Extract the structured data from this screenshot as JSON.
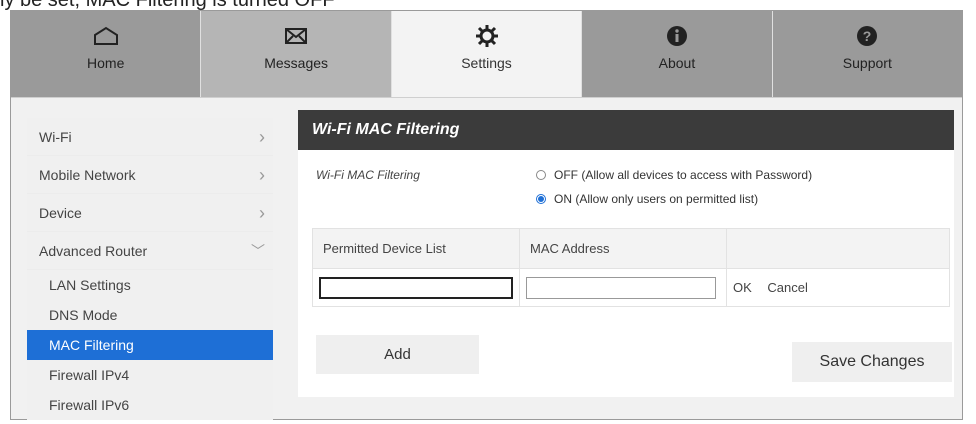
{
  "partial_text_top": "ly be set, MAC Filtering is turned OFF",
  "nav": {
    "tabs": [
      {
        "label": "Home",
        "icon": "home-icon"
      },
      {
        "label": "Messages",
        "icon": "envelope-icon"
      },
      {
        "label": "Settings",
        "icon": "gear-icon"
      },
      {
        "label": "About",
        "icon": "info-icon"
      },
      {
        "label": "Support",
        "icon": "question-icon"
      }
    ],
    "active": "Settings"
  },
  "sidebar": {
    "items": [
      {
        "label": "Wi-Fi"
      },
      {
        "label": "Mobile Network"
      },
      {
        "label": "Device"
      },
      {
        "label": "Advanced Router"
      }
    ],
    "subitems": [
      {
        "label": "LAN Settings"
      },
      {
        "label": "DNS Mode"
      },
      {
        "label": "MAC Filtering"
      },
      {
        "label": "Firewall IPv4"
      },
      {
        "label": "Firewall IPv6"
      }
    ],
    "active_subitem": "MAC Filtering"
  },
  "panel": {
    "title": "Wi-Fi MAC Filtering",
    "field_label": "Wi-Fi MAC Filtering",
    "options": [
      {
        "label": "OFF (Allow all devices to access with Password)",
        "checked": false
      },
      {
        "label": "ON (Allow only users on permitted list)",
        "checked": true
      }
    ],
    "table": {
      "headers": [
        "Permitted Device List",
        "MAC Address",
        ""
      ],
      "row": {
        "device_value": "",
        "mac_value": "",
        "ok": "OK",
        "cancel": "Cancel"
      }
    },
    "add_label": "Add",
    "save_label": "Save Changes"
  },
  "colors": {
    "accent": "#1e6fd6",
    "header": "#3b3b3b"
  }
}
